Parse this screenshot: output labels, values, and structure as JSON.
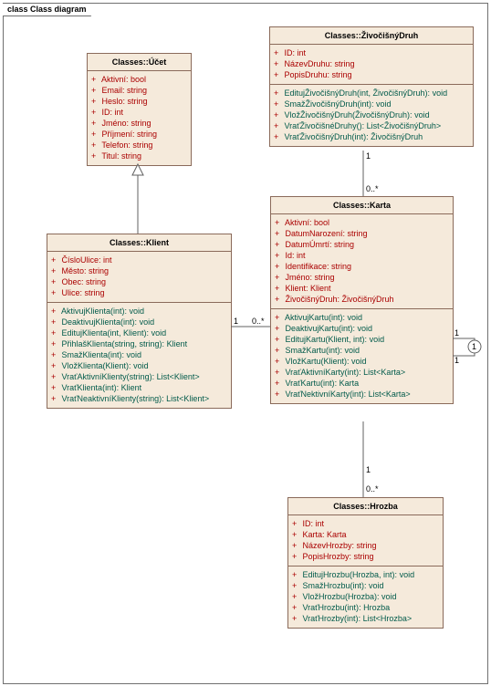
{
  "frame": {
    "title": "class Class diagram"
  },
  "classes": {
    "ucet": {
      "title": "Classes::Účet",
      "attrs": [
        {
          "v": "+",
          "n": "Aktivní",
          "t": "bool"
        },
        {
          "v": "+",
          "n": "Email",
          "t": "string"
        },
        {
          "v": "+",
          "n": "Heslo",
          "t": "string"
        },
        {
          "v": "+",
          "n": "ID",
          "t": "int"
        },
        {
          "v": "+",
          "n": "Jméno",
          "t": "string"
        },
        {
          "v": "+",
          "n": "Příjmení",
          "t": "string"
        },
        {
          "v": "+",
          "n": "Telefon",
          "t": "string"
        },
        {
          "v": "+",
          "n": "Titul",
          "t": "string"
        }
      ],
      "ops": []
    },
    "klient": {
      "title": "Classes::Klient",
      "attrs": [
        {
          "v": "+",
          "n": "ČísloUlice",
          "t": "int"
        },
        {
          "v": "+",
          "n": "Město",
          "t": "string"
        },
        {
          "v": "+",
          "n": "Obec",
          "t": "string"
        },
        {
          "v": "+",
          "n": "Ulice",
          "t": "string"
        }
      ],
      "ops": [
        {
          "v": "+",
          "n": "AktivujKlienta(int)",
          "t": "void"
        },
        {
          "v": "+",
          "n": "DeaktivujKlienta(int)",
          "t": "void"
        },
        {
          "v": "+",
          "n": "EditujKlienta(int, Klient)",
          "t": "void"
        },
        {
          "v": "+",
          "n": "PřihlašKlienta(string, string)",
          "t": "Klient"
        },
        {
          "v": "+",
          "n": "SmažKlienta(int)",
          "t": "void"
        },
        {
          "v": "+",
          "n": "VložKlienta(Klient)",
          "t": "void"
        },
        {
          "v": "+",
          "n": "VraťAktivníKlienty(string)",
          "t": "List<Klient>"
        },
        {
          "v": "+",
          "n": "VraťKlienta(int)",
          "t": "Klient"
        },
        {
          "v": "+",
          "n": "VraťNeaktivníKlienty(string)",
          "t": "List<Klient>"
        }
      ]
    },
    "druh": {
      "title": "Classes::ŽivočišnýDruh",
      "attrs": [
        {
          "v": "+",
          "n": "ID",
          "t": "int"
        },
        {
          "v": "+",
          "n": "NázevDruhu",
          "t": "string"
        },
        {
          "v": "+",
          "n": "PopisDruhu",
          "t": "string"
        }
      ],
      "ops": [
        {
          "v": "+",
          "n": "EditujŽivočišnýDruh(int, ŽivočišnýDruh)",
          "t": "void"
        },
        {
          "v": "+",
          "n": "SmažŽivočišnýDruh(int)",
          "t": "void"
        },
        {
          "v": "+",
          "n": "VložŽivočišnýDruh(ŽivočišnýDruh)",
          "t": "void"
        },
        {
          "v": "+",
          "n": "VraťŽivočišnéDruhy()",
          "t": "List<ŽivočišnýDruh>"
        },
        {
          "v": "+",
          "n": "VraťŽivočišnýDruh(int)",
          "t": "ŽivočišnýDruh"
        }
      ]
    },
    "karta": {
      "title": "Classes::Karta",
      "attrs": [
        {
          "v": "+",
          "n": "Aktivní",
          "t": "bool"
        },
        {
          "v": "+",
          "n": "DatumNarození",
          "t": "string"
        },
        {
          "v": "+",
          "n": "DatumÚmrtí",
          "t": "string"
        },
        {
          "v": "+",
          "n": "Id",
          "t": "int"
        },
        {
          "v": "+",
          "n": "Identifikace",
          "t": "string"
        },
        {
          "v": "+",
          "n": "Jméno",
          "t": "string"
        },
        {
          "v": "+",
          "n": "Klient",
          "t": "Klient"
        },
        {
          "v": "+",
          "n": "ŽivočišnýDruh",
          "t": "ŽivočišnýDruh"
        }
      ],
      "ops": [
        {
          "v": "+",
          "n": "AktivujKartu(int)",
          "t": "void"
        },
        {
          "v": "+",
          "n": "DeaktivujKartu(int)",
          "t": "void"
        },
        {
          "v": "+",
          "n": "EditujKartu(Klient, int)",
          "t": "void"
        },
        {
          "v": "+",
          "n": "SmažKartu(int)",
          "t": "void"
        },
        {
          "v": "+",
          "n": "VložKartu(Klient)",
          "t": "void"
        },
        {
          "v": "+",
          "n": "VraťAktivníKarty(int)",
          "t": "List<Karta>"
        },
        {
          "v": "+",
          "n": "VraťKartu(int)",
          "t": "Karta"
        },
        {
          "v": "+",
          "n": "VraťNektivníKarty(int)",
          "t": "List<Karta>"
        }
      ]
    },
    "hrozba": {
      "title": "Classes::Hrozba",
      "attrs": [
        {
          "v": "+",
          "n": "ID",
          "t": "int"
        },
        {
          "v": "+",
          "n": "Karta",
          "t": "Karta"
        },
        {
          "v": "+",
          "n": "NázevHrozby",
          "t": "string"
        },
        {
          "v": "+",
          "n": "PopisHrozby",
          "t": "string"
        }
      ],
      "ops": [
        {
          "v": "+",
          "n": "EditujHrozbu(Hrozba, int)",
          "t": "void"
        },
        {
          "v": "+",
          "n": "SmažHrozbu(int)",
          "t": "void"
        },
        {
          "v": "+",
          "n": "VložHrozbu(Hrozba)",
          "t": "void"
        },
        {
          "v": "+",
          "n": "VraťHrozbu(int)",
          "t": "Hrozba"
        },
        {
          "v": "+",
          "n": "VraťHrozby(int)",
          "t": "List<Hrozba>"
        }
      ]
    }
  },
  "mult": {
    "klient_karta_1": "1",
    "klient_karta_m": "0..*",
    "druh_karta_1": "1",
    "druh_karta_m": "0..*",
    "karta_hrozba_1": "1",
    "karta_hrozba_m": "0..*",
    "karta_self_1a": "1",
    "karta_self_1b": "1"
  }
}
